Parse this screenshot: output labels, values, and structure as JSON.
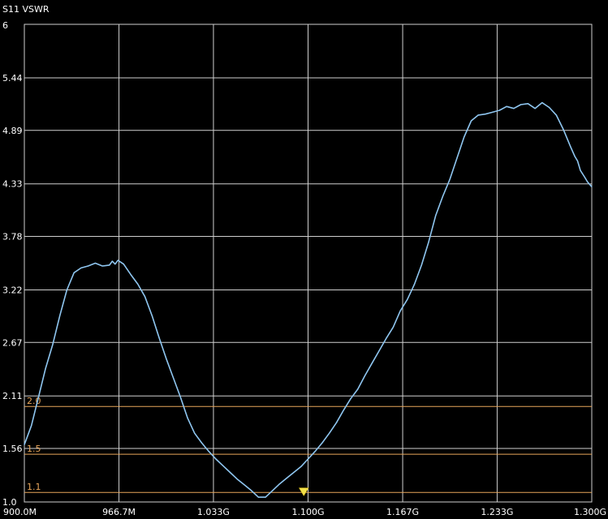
{
  "chart_data": {
    "type": "line",
    "title": "S11 VSWR",
    "x_tick_labels": [
      "900.0M",
      "966.7M",
      "1.033G",
      "1.100G",
      "1.167G",
      "1.233G",
      "1.300G"
    ],
    "x_ticks_mhz": [
      900.0,
      966.7,
      1033.3,
      1100.0,
      1166.7,
      1233.3,
      1300.0
    ],
    "y_tick_labels": [
      "6",
      "5.44",
      "4.89",
      "4.33",
      "3.78",
      "3.22",
      "2.67",
      "2.11",
      "1.56",
      "1.0"
    ],
    "y_ticks": [
      6.0,
      5.44,
      4.89,
      4.33,
      3.78,
      3.22,
      2.67,
      2.11,
      1.56,
      1.0
    ],
    "xlim_mhz": [
      900.0,
      1300.0
    ],
    "ylim": [
      1.0,
      6.0
    ],
    "grid": true,
    "reference_lines": [
      {
        "label": "2.0",
        "value": 2.0,
        "color": "#e8a65a"
      },
      {
        "label": "1.5",
        "value": 1.5,
        "color": "#e8a65a"
      },
      {
        "label": "1.1",
        "value": 1.1,
        "color": "#e8a65a"
      }
    ],
    "marker": {
      "x_mhz": 1097.0,
      "y": 1.08,
      "color": "#f2e04a"
    },
    "series": [
      {
        "color": "#8fc6f0",
        "x_mhz": [
          900,
          905,
          910,
          915,
          920,
          925,
          930,
          935,
          940,
          945,
          950,
          955,
          960,
          962,
          964,
          966,
          968,
          970,
          975,
          980,
          985,
          990,
          995,
          1000,
          1005,
          1010,
          1015,
          1020,
          1025,
          1030,
          1035,
          1040,
          1045,
          1050,
          1055,
          1060,
          1065,
          1070,
          1075,
          1080,
          1085,
          1090,
          1095,
          1100,
          1105,
          1110,
          1115,
          1120,
          1125,
          1130,
          1135,
          1140,
          1145,
          1150,
          1155,
          1160,
          1165,
          1170,
          1175,
          1180,
          1185,
          1190,
          1195,
          1200,
          1205,
          1210,
          1215,
          1220,
          1225,
          1230,
          1235,
          1240,
          1245,
          1250,
          1255,
          1260,
          1265,
          1270,
          1275,
          1280,
          1285,
          1288,
          1290,
          1292,
          1295,
          1297,
          1300
        ],
        "values": [
          1.6,
          1.8,
          2.1,
          2.4,
          2.65,
          2.95,
          3.22,
          3.4,
          3.45,
          3.47,
          3.5,
          3.47,
          3.48,
          3.52,
          3.49,
          3.53,
          3.51,
          3.49,
          3.38,
          3.28,
          3.15,
          2.95,
          2.72,
          2.5,
          2.3,
          2.1,
          1.88,
          1.72,
          1.62,
          1.53,
          1.45,
          1.38,
          1.31,
          1.24,
          1.18,
          1.12,
          1.05,
          1.05,
          1.12,
          1.19,
          1.25,
          1.31,
          1.37,
          1.45,
          1.53,
          1.62,
          1.72,
          1.83,
          1.96,
          2.08,
          2.18,
          2.32,
          2.45,
          2.58,
          2.71,
          2.83,
          3.0,
          3.12,
          3.28,
          3.48,
          3.72,
          4.0,
          4.2,
          4.38,
          4.6,
          4.82,
          4.99,
          5.05,
          5.06,
          5.08,
          5.1,
          5.14,
          5.12,
          5.16,
          5.17,
          5.12,
          5.18,
          5.13,
          5.05,
          4.9,
          4.72,
          4.62,
          4.57,
          4.47,
          4.4,
          4.35,
          4.3
        ]
      }
    ]
  }
}
